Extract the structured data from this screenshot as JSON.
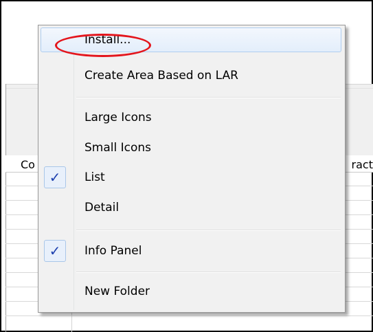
{
  "background": {
    "column_header_left": "Co",
    "column_header_right": "ract"
  },
  "context_menu": {
    "items": [
      {
        "label": "Install...",
        "highlighted": true,
        "checked": false,
        "interactable": true
      },
      {
        "label": "Create Area Based on LAR",
        "highlighted": false,
        "checked": false
      },
      {
        "label": "Large Icons",
        "checked": false
      },
      {
        "label": "Small Icons",
        "checked": false
      },
      {
        "label": "List",
        "checked": true
      },
      {
        "label": "Detail",
        "checked": false
      },
      {
        "label": "Info Panel",
        "checked": true
      },
      {
        "label": "New Folder",
        "checked": false
      }
    ],
    "check_glyph": "✓",
    "annotation_color": "#e4151c",
    "check_color": "#1c3fae"
  }
}
